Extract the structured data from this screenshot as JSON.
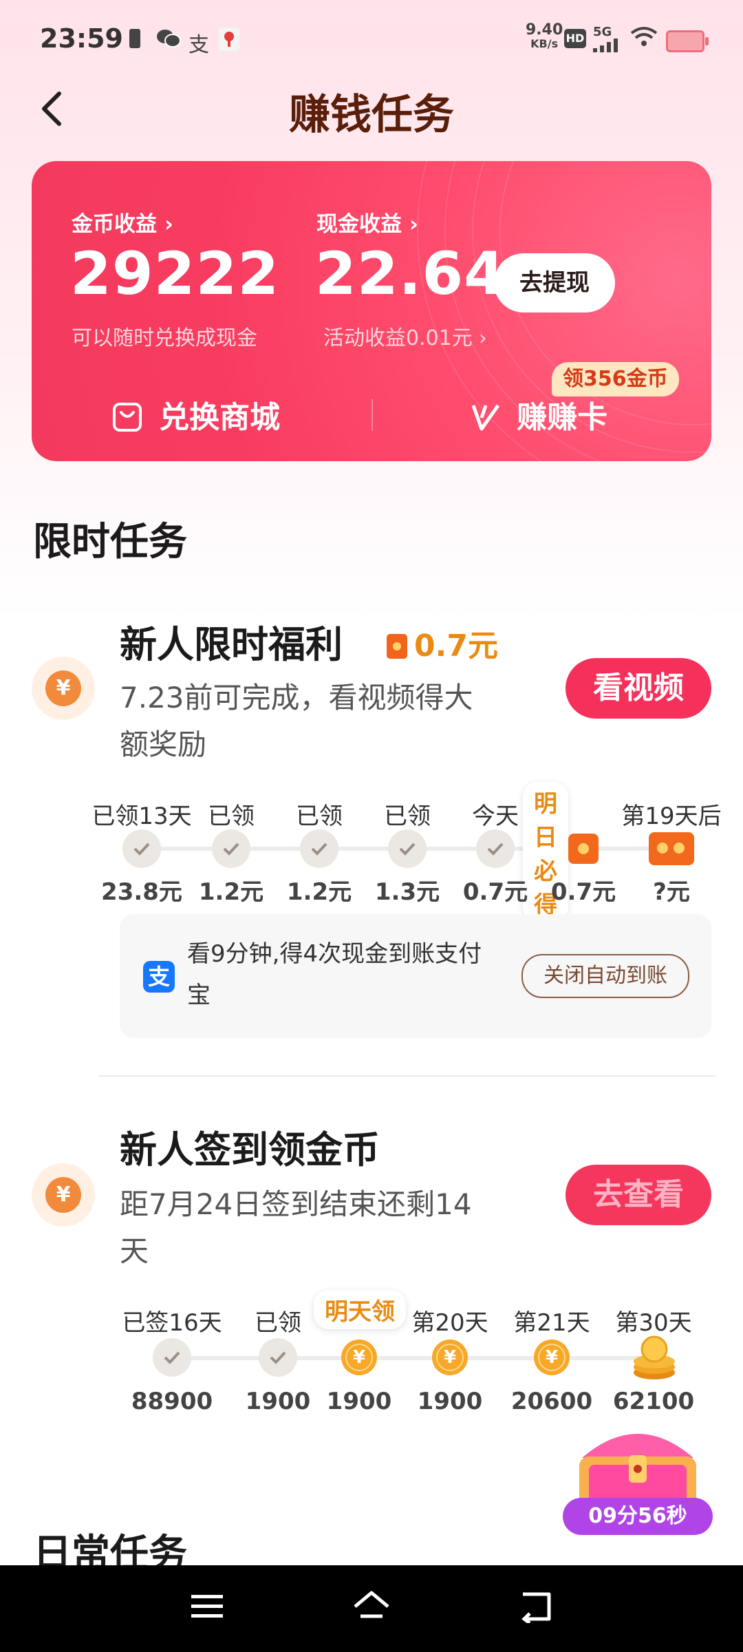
{
  "status_bar": {
    "time": "23:59",
    "network_speed_top": "9.40",
    "network_speed_unit": "KB/s",
    "hd": "HD",
    "signal": "5G",
    "icons": [
      "battery-small-icon",
      "wechat-icon",
      "alipay-icon",
      "location-pin-icon",
      "wifi-icon",
      "battery-icon"
    ]
  },
  "header": {
    "title": "赚钱任务"
  },
  "earnings": {
    "coin_label": "金币收益",
    "coin_value": "29222",
    "coin_sub": "可以随时兑换成现金",
    "cash_label": "现金收益",
    "cash_value": "22.64",
    "cash_sub": "活动收益0.01元",
    "withdraw": "去提现",
    "mall": "兑换商城",
    "card_link": "赚赚卡",
    "coin_tag": "领356金币"
  },
  "limited_section": "限时任务",
  "task1": {
    "title": "新人限时福利",
    "reward": "0.7元",
    "desc_line1": "7.23前可完成，看视频得大",
    "desc_line2": "额奖励",
    "button": "看视频",
    "steps": [
      {
        "label": "已领13天",
        "value": "23.8元"
      },
      {
        "label": "已领",
        "value": "1.2元"
      },
      {
        "label": "已领",
        "value": "1.2元"
      },
      {
        "label": "已领",
        "value": "1.3元"
      },
      {
        "label": "今天",
        "value": "0.7元"
      },
      {
        "label": "明日必得",
        "value": "0.7元"
      },
      {
        "label": "第19天后",
        "value": "?元"
      }
    ],
    "alipay_text_line1": "看9分钟,得4次现金到账支付",
    "alipay_text_line2": "宝",
    "auto_button": "关闭自动到账"
  },
  "task2": {
    "title": "新人签到领金币",
    "desc_line1": "距7月24日签到结束还剩14",
    "desc_line2": "天",
    "button": "去查看",
    "steps": [
      {
        "label": "已签16天",
        "value": "88900"
      },
      {
        "label": "已领",
        "value": "1900"
      },
      {
        "label": "明天领",
        "value": "1900"
      },
      {
        "label": "第20天",
        "value": "1900"
      },
      {
        "label": "第21天",
        "value": "20600"
      },
      {
        "label": "第30天",
        "value": "62100"
      }
    ]
  },
  "daily_section": "日常任务",
  "treasure": {
    "timer": "09分56秒"
  },
  "colors": {
    "accent": "#f5305a",
    "gold": "#e98b12",
    "title_brown": "#5a1e0a",
    "timer_purple": "#b044e6"
  }
}
